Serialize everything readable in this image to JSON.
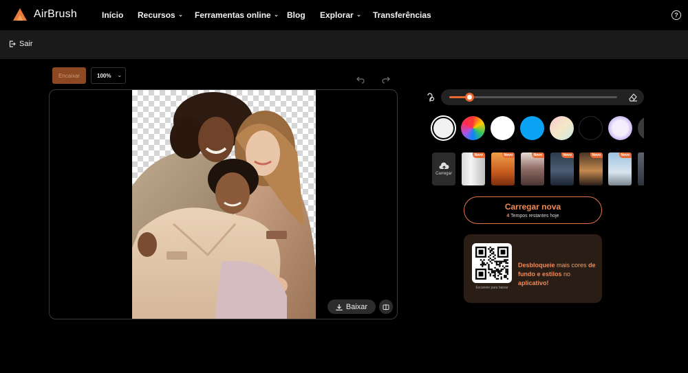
{
  "app": {
    "name": "AirBrush",
    "brand_color": "#f07a3a"
  },
  "nav": {
    "items": [
      {
        "label": "Início",
        "has_dropdown": false
      },
      {
        "label": "Recursos",
        "has_dropdown": true
      },
      {
        "label": "Ferramentas online",
        "has_dropdown": true
      },
      {
        "label": "Blog",
        "has_dropdown": false
      },
      {
        "label": "Explorar",
        "has_dropdown": true
      },
      {
        "label": "Transferências",
        "has_dropdown": false
      }
    ],
    "help_icon": "question-circle-icon"
  },
  "subbar": {
    "back_label": "Sair"
  },
  "toolbar": {
    "fit_label": "Encaixar",
    "zoom_value": "100%",
    "undo_icon": "undo-icon",
    "redo_icon": "redo-icon"
  },
  "canvas": {
    "download_label": "Baixar",
    "compare_icon": "compare-icon"
  },
  "brush": {
    "size_fraction": 0.12,
    "brush_icon": "brush-icon",
    "eraser_icon": "eraser-icon",
    "accent_color": "#e86a32"
  },
  "background_colors": [
    {
      "name": "light-gray",
      "color": "#f1f1f1",
      "selected": true
    },
    {
      "name": "rainbow",
      "color": "conic",
      "selected": false
    },
    {
      "name": "white",
      "color": "#ffffff",
      "selected": false
    },
    {
      "name": "sky-blue",
      "color": "#0aa2f3",
      "selected": false
    },
    {
      "name": "pastel-gradient",
      "color": "gradient",
      "selected": false
    },
    {
      "name": "black",
      "color": "#000000",
      "selected": false
    },
    {
      "name": "lavender-ring",
      "color": "radial",
      "selected": false
    },
    {
      "name": "dark",
      "color": "#3a3a3a",
      "selected": false
    }
  ],
  "backgrounds": {
    "upload_label": "Carregar",
    "new_badge": "Novo",
    "tiles": [
      {
        "name": "white-studio"
      },
      {
        "name": "autumn-forest"
      },
      {
        "name": "pagoda-street"
      },
      {
        "name": "night-city"
      },
      {
        "name": "luxury-lobby"
      },
      {
        "name": "eiffel-tower"
      },
      {
        "name": "city-partial"
      }
    ]
  },
  "upload": {
    "label": "Carregar nova",
    "remaining_count": "4",
    "remaining_text": "Tempos restantes hoje"
  },
  "promo": {
    "qr_caption": "Escaneie para baixar",
    "text_a": "Desbloqueie",
    "text_b": "mais cores",
    "text_c": "de fundo e estilos",
    "text_d": "no",
    "text_e": "aplicativo!"
  }
}
